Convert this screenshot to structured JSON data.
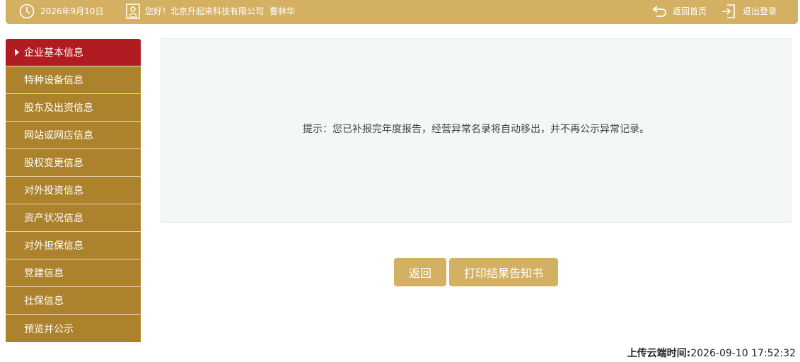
{
  "header": {
    "date": "2026年9月10日",
    "greeting": "您好！北京升起来科技有限公司",
    "user_name": "曹林华",
    "home_link": "返回首页",
    "logout_link": "退出登录",
    "icons": [
      "clock-icon",
      "user-badge-icon",
      "return-arrow-icon",
      "logout-icon"
    ]
  },
  "sidebar": {
    "items": [
      {
        "label": "企业基本信息"
      },
      {
        "label": "特种设备信息"
      },
      {
        "label": "股东及出资信息"
      },
      {
        "label": "网站或网店信息"
      },
      {
        "label": "股权变更信息"
      },
      {
        "label": "对外投资信息"
      },
      {
        "label": "资产状况信息"
      },
      {
        "label": "对外担保信息"
      },
      {
        "label": "党建信息"
      },
      {
        "label": "社保信息"
      },
      {
        "label": "预览并公示"
      }
    ],
    "active_index": 0
  },
  "main": {
    "notice": "提示：您已补报完年度报告，经营异常名录将自动移出，并不再公示异常记录。",
    "back_button": "返回",
    "print_button": "打印结果告知书"
  },
  "footer": {
    "upload_label": "上传云端时间:",
    "upload_time": "2026-09-10 17:52:32"
  },
  "colors": {
    "gold": "#d4b062",
    "sidebar": "#ad822d",
    "active": "#b01c21"
  }
}
